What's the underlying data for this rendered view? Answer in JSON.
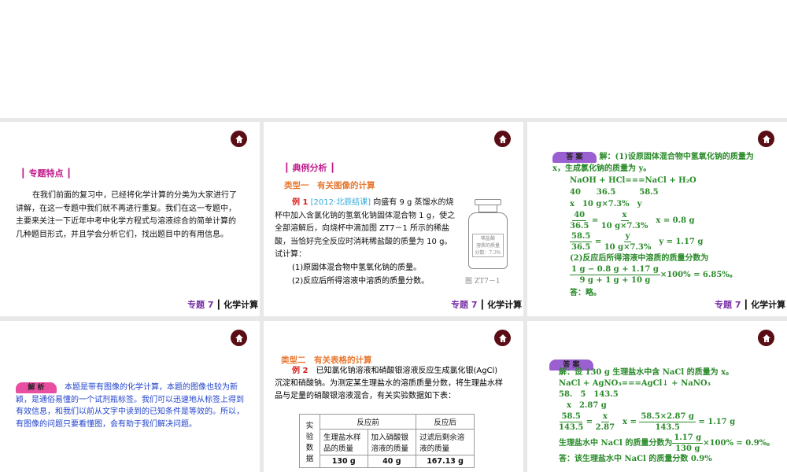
{
  "footer": {
    "topic": "专题 7",
    "separator": "┃",
    "name": "化学计算"
  },
  "slide1": {
    "section": "┃ 专题特点 ┃",
    "text": "在我们前面的复习中，已经将化学计算的分类为大家进行了讲解，在这一专题中我们就不再进行重复。我们在这一专题中，主要来关注一下近年中考中化学方程式与溶液综合的简单计算的几种题目形式，并且学会分析它们，找出题目中的有用信息。"
  },
  "slide2": {
    "section": "┃ 典例分析 ┃",
    "type": "类型一　有关图像的计算",
    "ex_label": "例 1",
    "source": "[2012·北辰结课]",
    "text": "向盛有 9 g 蒸馏水的烧杯中加入含氯化钠的氢氧化钠固体混合物 1 g，使之全部溶解后，向烧杯中滴加图 ZT7－1 所示的稀盐酸，当恰好完全反应时消耗稀盐酸的质量为 10 g。试计算：",
    "q1": "(1)原固体混合物中氢氧化钠的质量。",
    "q2": "(2)反应后所得溶液中溶质的质量分数。",
    "label_lines": [
      "稀盐酸",
      "溶质的质量",
      "分数：7.3%"
    ],
    "figure_caption": "图 ZT7－1"
  },
  "slide3": {
    "banner": "答 案",
    "l1": "解：(1)设原固体混合物中氢氧化钠的质量为 x，生成氯化钠的质量为 y。",
    "eq": "NaOH + HCl===NaCl + H₂O",
    "m1": "40　　36.5　　　58.5",
    "m2": "x　10 g×7.3%　y",
    "f1n": "40",
    "f1d": "36.5",
    "f1rn": "x",
    "f1rd": "10 g×7.3%",
    "r1": "x = 0.8 g",
    "f2n": "58.5",
    "f2d": "36.5",
    "f2rn": "y",
    "f2rd": "10 g×7.3%",
    "r2": "y = 1.17 g",
    "p2": "(2)反应后所得溶液中溶质的质量分数为",
    "f3n": "1 g − 0.8 g + 1.17 g",
    "f3d": "9 g + 1 g + 10 g",
    "r3": "×100% = 6.85%。",
    "ans": "答：略。"
  },
  "slide4": {
    "banner": "解 析",
    "text": "本题是带有图像的化学计算，本题的图像也较为新颖，是通俗易懂的一个试剂瓶标签。我们可以迅速地从标签上得到有效信息，和我们以前从文字中读到的已知条件是等效的。所以，有图像的问题只要看懂图，会有助于我们解决问题。"
  },
  "slide5": {
    "type": "类型二　有关表格的计算",
    "ex_label": "例 2",
    "text": "已知氯化钠溶液和硝酸银溶液反应生成氯化银(AgCl)沉淀和硝酸钠。为测定某生理盐水的溶质质量分数，将生理盐水样品与足量的硝酸银溶液混合，有关实验数据如下表：",
    "table": {
      "row_head": "实验数据",
      "before": "反应前",
      "after": "反应后",
      "cols": [
        "生理盐水样品的质量",
        "加入硝酸银溶液的质量",
        "过滤后剩余溶液的质量"
      ],
      "values": [
        "130 g",
        "40 g",
        "167.13 g"
      ]
    }
  },
  "slide6": {
    "banner": "答 案",
    "l1": "解：设 130 g 生理盐水中含 NaCl 的质量为 x。",
    "eq": "NaCl + AgNO₃===AgCl↓ + NaNO₃",
    "m1": "58.　5　143.5",
    "m2": "x　2.87 g",
    "f1n": "58.5",
    "f1d": "143.5",
    "f1rn": "x",
    "f1rd": "2.87",
    "xeq": "x =",
    "f2n": "58.5×2.87 g",
    "f2d": "143.5",
    "r1": "= 1.17 g",
    "p2": "生理盐水中 NaCl 的质量分数为",
    "f3n": "1.17 g",
    "f3d": "130 g",
    "r3": "×100% = 0.9%。",
    "ans": "答：该生理盐水中 NaCl 的质量分数 0.9%"
  },
  "colors": {
    "home": "#5a0d14",
    "magenta": "#c0198c",
    "green": "#2a8a2a",
    "blue": "#2244cc",
    "orange": "#e8772e"
  }
}
